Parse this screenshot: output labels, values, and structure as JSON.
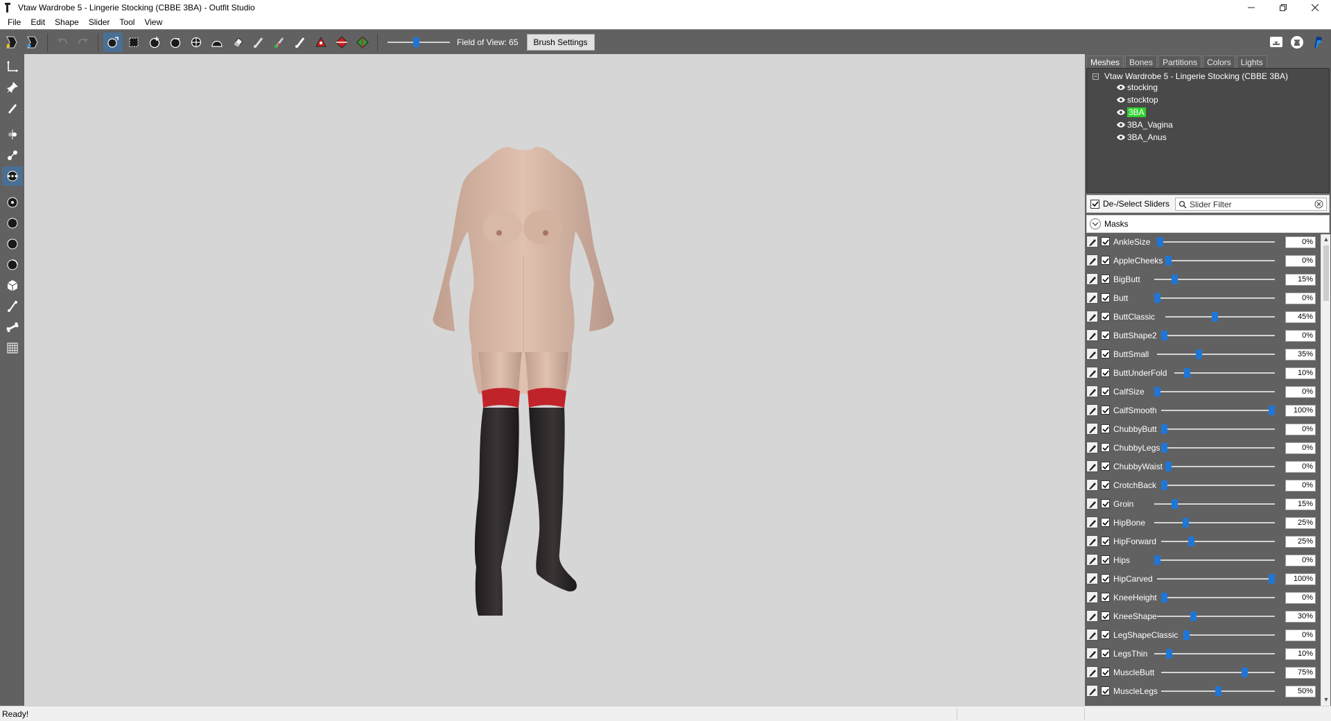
{
  "window": {
    "title": "Vtaw Wardrobe 5 - Lingerie Stocking (CBBE 3BA) - Outfit Studio",
    "controls": [
      "minimize-icon",
      "restore-icon",
      "close-icon"
    ]
  },
  "menu": [
    "File",
    "Edit",
    "Shape",
    "Slider",
    "Tool",
    "View"
  ],
  "toolbar": {
    "fov_label": "Field of View: 65",
    "fov_value": 65,
    "brush_settings_label": "Brush Settings",
    "active_tool": "select-brush",
    "right_icons": [
      "discord-icon",
      "github-icon",
      "paypal-icon"
    ]
  },
  "right_panel": {
    "tabs": [
      "Meshes",
      "Bones",
      "Partitions",
      "Colors",
      "Lights"
    ],
    "active_tab": "Meshes",
    "tree": {
      "root": "Vtaw Wardrobe 5 - Lingerie Stocking (CBBE 3BA)",
      "items": [
        "stocking",
        "stocktop",
        "3BA",
        "3BA_Vagina",
        "3BA_Anus"
      ],
      "selected": "3BA"
    },
    "deselect_label": "De-/Select Sliders",
    "filter_placeholder": "Slider Filter",
    "masks_label": "Masks"
  },
  "sliders": [
    {
      "name": "AnkleSize",
      "value": "0%",
      "pct": 0
    },
    {
      "name": "AppleCheeks",
      "value": "0%",
      "pct": 0
    },
    {
      "name": "BigButt",
      "value": "15%",
      "pct": 15
    },
    {
      "name": "Butt",
      "value": "0%",
      "pct": 0
    },
    {
      "name": "ButtClassic",
      "value": "45%",
      "pct": 45
    },
    {
      "name": "ButtShape2",
      "value": "0%",
      "pct": 0
    },
    {
      "name": "ButtSmall",
      "value": "35%",
      "pct": 35
    },
    {
      "name": "ButtUnderFold",
      "value": "10%",
      "pct": 10
    },
    {
      "name": "CalfSize",
      "value": "0%",
      "pct": 0
    },
    {
      "name": "CalfSmooth",
      "value": "100%",
      "pct": 100
    },
    {
      "name": "ChubbyButt",
      "value": "0%",
      "pct": 0
    },
    {
      "name": "ChubbyLegs",
      "value": "0%",
      "pct": 0
    },
    {
      "name": "ChubbyWaist",
      "value": "0%",
      "pct": 0
    },
    {
      "name": "CrotchBack",
      "value": "0%",
      "pct": 0
    },
    {
      "name": "Groin",
      "value": "15%",
      "pct": 15
    },
    {
      "name": "HipBone",
      "value": "25%",
      "pct": 25
    },
    {
      "name": "HipForward",
      "value": "25%",
      "pct": 25
    },
    {
      "name": "Hips",
      "value": "0%",
      "pct": 0
    },
    {
      "name": "HipCarved",
      "value": "100%",
      "pct": 100
    },
    {
      "name": "KneeHeight",
      "value": "0%",
      "pct": 0
    },
    {
      "name": "KneeShape",
      "value": "30%",
      "pct": 30
    },
    {
      "name": "LegShapeClassic",
      "value": "0%",
      "pct": 0
    },
    {
      "name": "LegsThin",
      "value": "10%",
      "pct": 10
    },
    {
      "name": "MuscleButt",
      "value": "75%",
      "pct": 75
    },
    {
      "name": "MuscleLegs",
      "value": "50%",
      "pct": 50
    }
  ],
  "status": {
    "text": "Ready!"
  },
  "colors": {
    "accent": "#1f76d6",
    "panel": "#616161",
    "viewport": "#d6d6d6",
    "selected_mesh": "#2fd12f",
    "stocking": "#2a2627",
    "lace": "#c0232a",
    "skin": "#d9b5a3"
  }
}
